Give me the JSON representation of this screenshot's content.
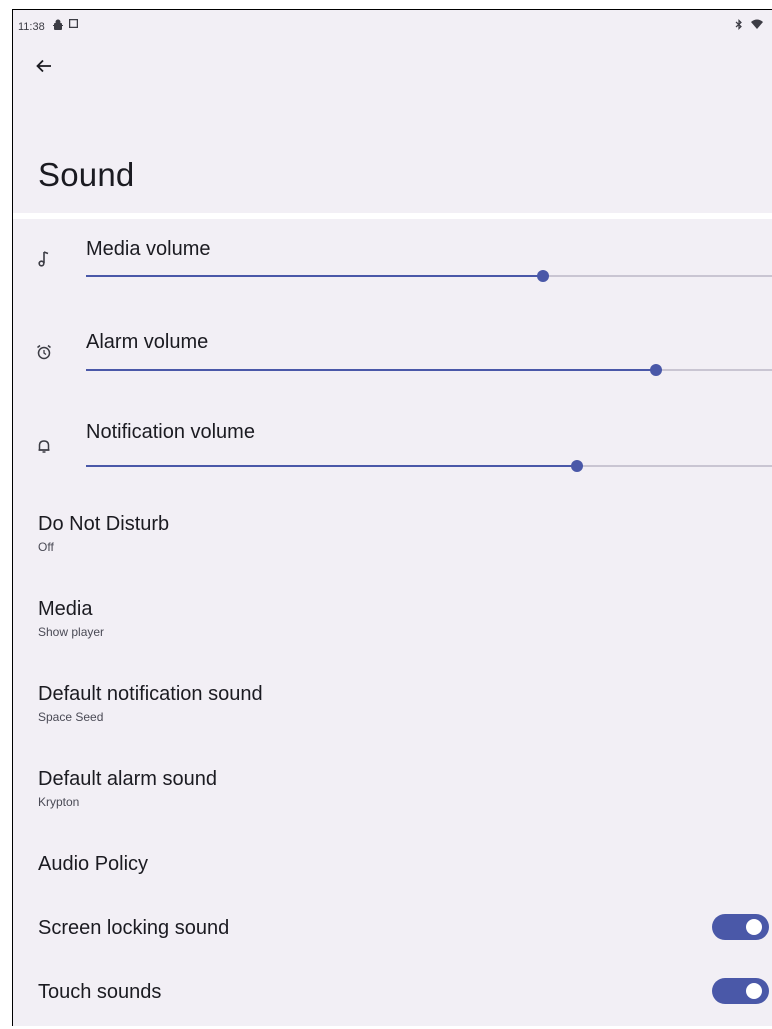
{
  "status_bar": {
    "time": "11:38",
    "left_icons": [
      "android-debug-icon",
      "screenshot-icon"
    ],
    "right_icons": [
      "bluetooth-icon",
      "wifi-icon"
    ]
  },
  "header": {
    "back_icon": "arrow-back-icon",
    "title": "Sound"
  },
  "sliders": [
    {
      "id": "media",
      "label": "Media volume",
      "icon": "music-note-icon",
      "value": 0.665
    },
    {
      "id": "alarm",
      "label": "Alarm volume",
      "icon": "alarm-clock-icon",
      "value": 0.83
    },
    {
      "id": "notification",
      "label": "Notification volume",
      "icon": "bell-icon",
      "value": 0.715
    }
  ],
  "preferences": [
    {
      "id": "dnd",
      "title": "Do Not Disturb",
      "summary": "Off"
    },
    {
      "id": "media",
      "title": "Media",
      "summary": "Show player"
    },
    {
      "id": "notif_sound",
      "title": "Default notification sound",
      "summary": "Space Seed"
    },
    {
      "id": "alarm_sound",
      "title": "Default alarm sound",
      "summary": "Krypton"
    },
    {
      "id": "audio_policy",
      "title": "Audio Policy",
      "summary": ""
    }
  ],
  "toggles": [
    {
      "id": "screen_lock",
      "title": "Screen locking sound",
      "on": true
    },
    {
      "id": "touch",
      "title": "Touch sounds",
      "on": true
    }
  ],
  "colors": {
    "background": "#f2eff5",
    "accent": "#4a58a8",
    "text": "#1b1b21"
  }
}
